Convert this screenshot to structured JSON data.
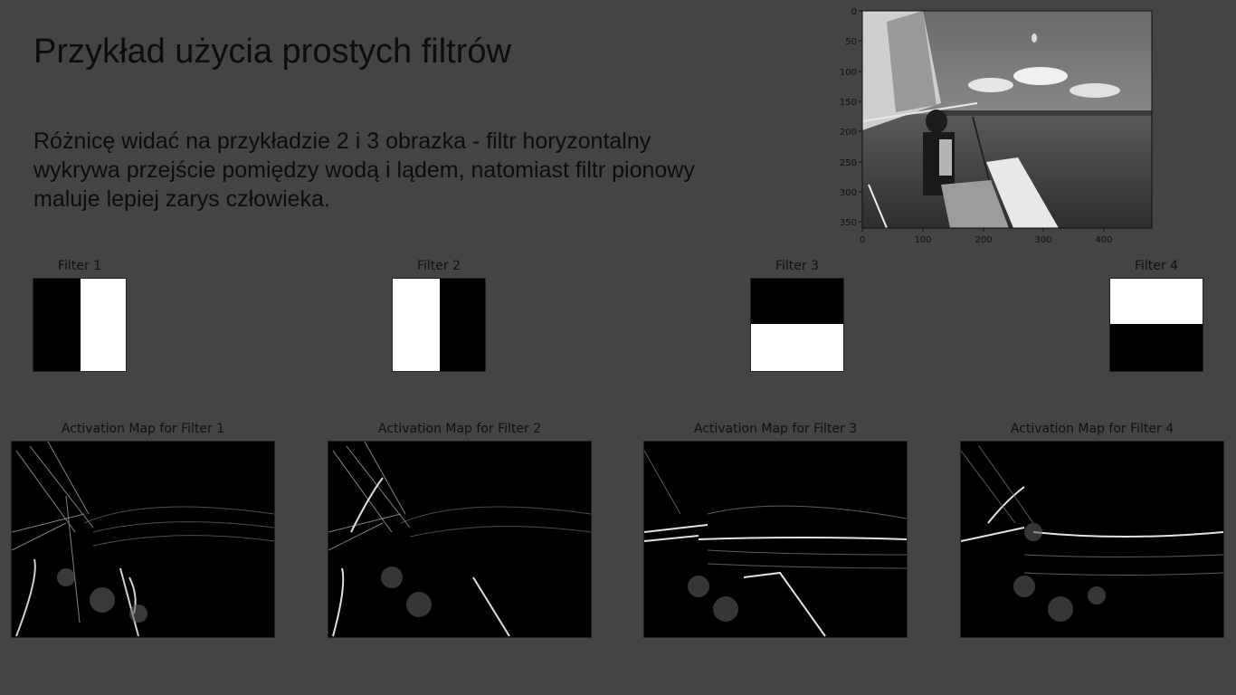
{
  "slide": {
    "title": "Przykład użycia prostych filtrów",
    "description": "Różnicę widać na przykładzie 2 i 3 obrazka - filtr horyzontalny wykrywa przejście pomiędzy wodą i lądem, natomiast filtr pionowy maluje lepiej zarys człowieka."
  },
  "photo_plot": {
    "xticks": [
      "0",
      "100",
      "200",
      "300",
      "400"
    ],
    "yticks": [
      "0",
      "50",
      "100",
      "150",
      "200",
      "250",
      "300",
      "350"
    ]
  },
  "filters": [
    {
      "title": "Filter 1"
    },
    {
      "title": "Filter 2"
    },
    {
      "title": "Filter 3"
    },
    {
      "title": "Filter 4"
    }
  ],
  "activation_maps": [
    {
      "title": "Activation Map for Filter 1"
    },
    {
      "title": "Activation Map for Filter 2"
    },
    {
      "title": "Activation Map for Filter 3"
    },
    {
      "title": "Activation Map for Filter 4"
    }
  ],
  "colors": {
    "background": "#444444",
    "text": "#0d0d0d"
  }
}
